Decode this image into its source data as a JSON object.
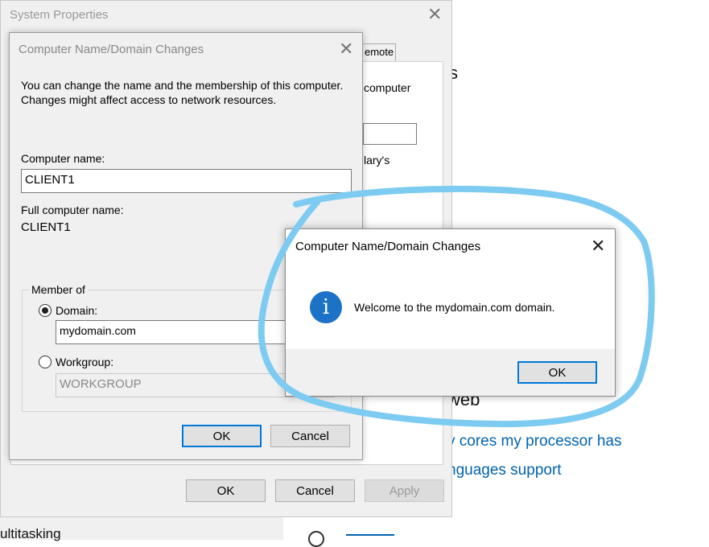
{
  "background_page": {
    "heading_fragment": "s",
    "web_heading": "web",
    "link1": "y cores my processor has",
    "link2": "nguages support",
    "bottom_left_text": "ultitasking"
  },
  "system_properties": {
    "title": "System Properties",
    "tab_fragment": "emote",
    "side_text1": "computer",
    "side_text2": "lary's",
    "buttons": {
      "ok": "OK",
      "cancel": "Cancel",
      "apply": "Apply"
    }
  },
  "computer_name_dialog": {
    "title": "Computer Name/Domain Changes",
    "description": "You can change the name and the membership of this computer. Changes might affect access to network resources.",
    "computer_name_label": "Computer name:",
    "computer_name_value": "CLIENT1",
    "full_name_label": "Full computer name:",
    "full_name_value": "CLIENT1",
    "member_of_label": "Member of",
    "domain_label": "Domain:",
    "domain_value": "mydomain.com",
    "workgroup_label": "Workgroup:",
    "workgroup_value": "WORKGROUP",
    "selected": "domain",
    "buttons": {
      "ok": "OK",
      "cancel": "Cancel"
    }
  },
  "welcome_dialog": {
    "title": "Computer Name/Domain Changes",
    "icon": "info-icon",
    "message": "Welcome to the mydomain.com domain.",
    "ok": "OK"
  },
  "colors": {
    "annotation": "#7ecbf2",
    "accent": "#0078d7",
    "info": "#1c72c6",
    "link": "#0063b1"
  }
}
